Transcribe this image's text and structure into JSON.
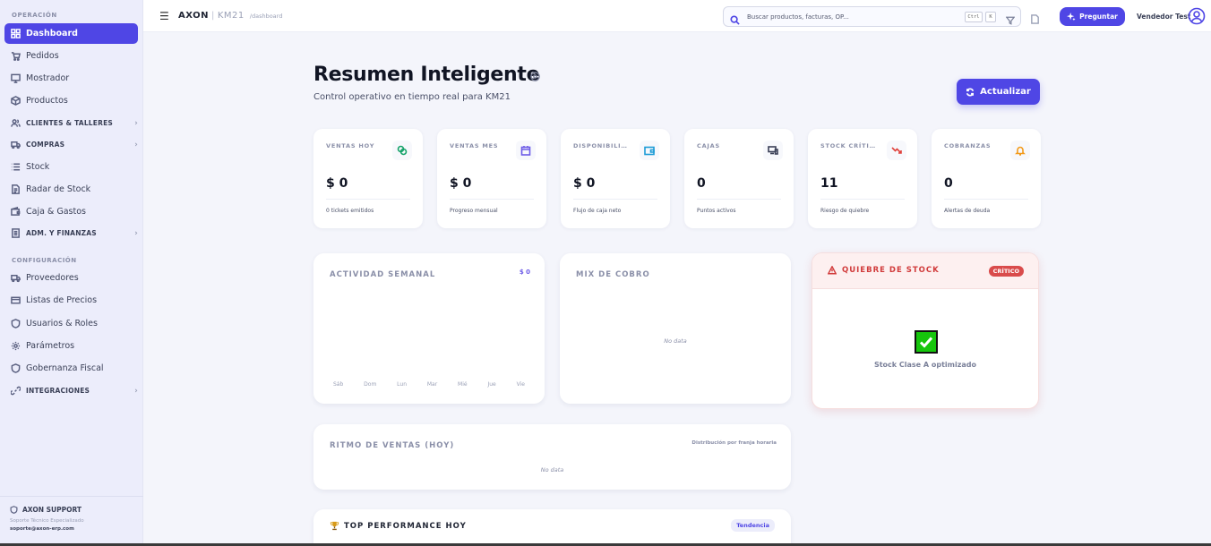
{
  "sidebar": {
    "section_operacion": "OPERACIÓN",
    "section_config": "CONFIGURACIÓN",
    "items": [
      {
        "label": "Dashboard",
        "icon": "grid-icon"
      },
      {
        "label": "Pedidos",
        "icon": "cart-icon"
      },
      {
        "label": "Mostrador",
        "icon": "monitor-icon"
      },
      {
        "label": "Productos",
        "icon": "box-icon"
      },
      {
        "label": "CLIENTES & TALLERES",
        "icon": "users-icon"
      },
      {
        "label": "COMPRAS",
        "icon": "truck-icon"
      },
      {
        "label": "Stock",
        "icon": "list-icon"
      },
      {
        "label": "Radar de Stock",
        "icon": "document-icon"
      },
      {
        "label": "Caja & Gastos",
        "icon": "wallet-icon"
      },
      {
        "label": "ADM. Y FINANZAS",
        "icon": "ledger-icon"
      },
      {
        "label": "Proveedores",
        "icon": "truck-icon"
      },
      {
        "label": "Listas de Precios",
        "icon": "card-icon"
      },
      {
        "label": "Usuarios & Roles",
        "icon": "shield-icon"
      },
      {
        "label": "Parámetros",
        "icon": "gear-icon"
      },
      {
        "label": "Gobernanza Fiscal",
        "icon": "shield-icon"
      },
      {
        "label": "INTEGRACIONES",
        "icon": "link-icon"
      }
    ],
    "support": {
      "title": "AXON SUPPORT",
      "line1": "Soporte Técnico Especializado",
      "email": "soporte@axon-erp.com"
    }
  },
  "topbar": {
    "brand": "AXON",
    "instance": "KM21",
    "path": "/dashboard",
    "search_placeholder": "Buscar productos, facturas, OP...",
    "kbd_ctrl": "Ctrl",
    "kbd_k": "K",
    "ask_label": "Preguntar",
    "user_name": "Vendedor Test"
  },
  "header": {
    "title": "Resumen Inteligente",
    "subtitle": "Control operativo en tiempo real para KM21",
    "refresh_label": "Actualizar"
  },
  "kpis": [
    {
      "label": "VENTAS HOY",
      "value": "$ 0",
      "note": "0 tickets emitidos",
      "icon": "coins-icon",
      "color": "#16a36a"
    },
    {
      "label": "VENTAS MES",
      "value": "$ 0",
      "note": "Progreso mensual",
      "icon": "calendar-icon",
      "color": "#6d5ce7"
    },
    {
      "label": "DISPONIBILIDAD",
      "value": "$ 0",
      "note": "Flujo de caja neto",
      "icon": "wallet-icon",
      "color": "#1c9bd6"
    },
    {
      "label": "CAJAS",
      "value": "0",
      "note": "Puntos activos",
      "icon": "devices-icon",
      "color": "#3a4057"
    },
    {
      "label": "STOCK CRÍTICO",
      "value": "11",
      "note": "Riesgo de quiebre",
      "icon": "trend-down-icon",
      "color": "#e0413b"
    },
    {
      "label": "COBRANZAS",
      "value": "0",
      "note": "Alertas de deuda",
      "icon": "bell-icon",
      "color": "#f29a1b"
    }
  ],
  "weekly": {
    "title": "ACTIVIDAD SEMANAL",
    "total": "$ 0",
    "days": [
      "Sáb",
      "Dom",
      "Lun",
      "Mar",
      "Mié",
      "Jue",
      "Vie"
    ]
  },
  "mix": {
    "title": "MIX DE COBRO",
    "empty": "No data"
  },
  "stock_alert": {
    "title": "QUIEBRE DE STOCK",
    "badge": "CRÍTICO",
    "message": "Stock Clase A optimizado"
  },
  "rhythm": {
    "title": "RITMO DE VENTAS (HOY)",
    "note": "Distribución por franja horaria",
    "empty": "No data"
  },
  "top": {
    "title": "TOP PERFORMANCE HOY",
    "badge": "Tendencia"
  },
  "colors": {
    "accent": "#4f46e5",
    "danger": "#d94b4b",
    "success": "#16c60c"
  }
}
